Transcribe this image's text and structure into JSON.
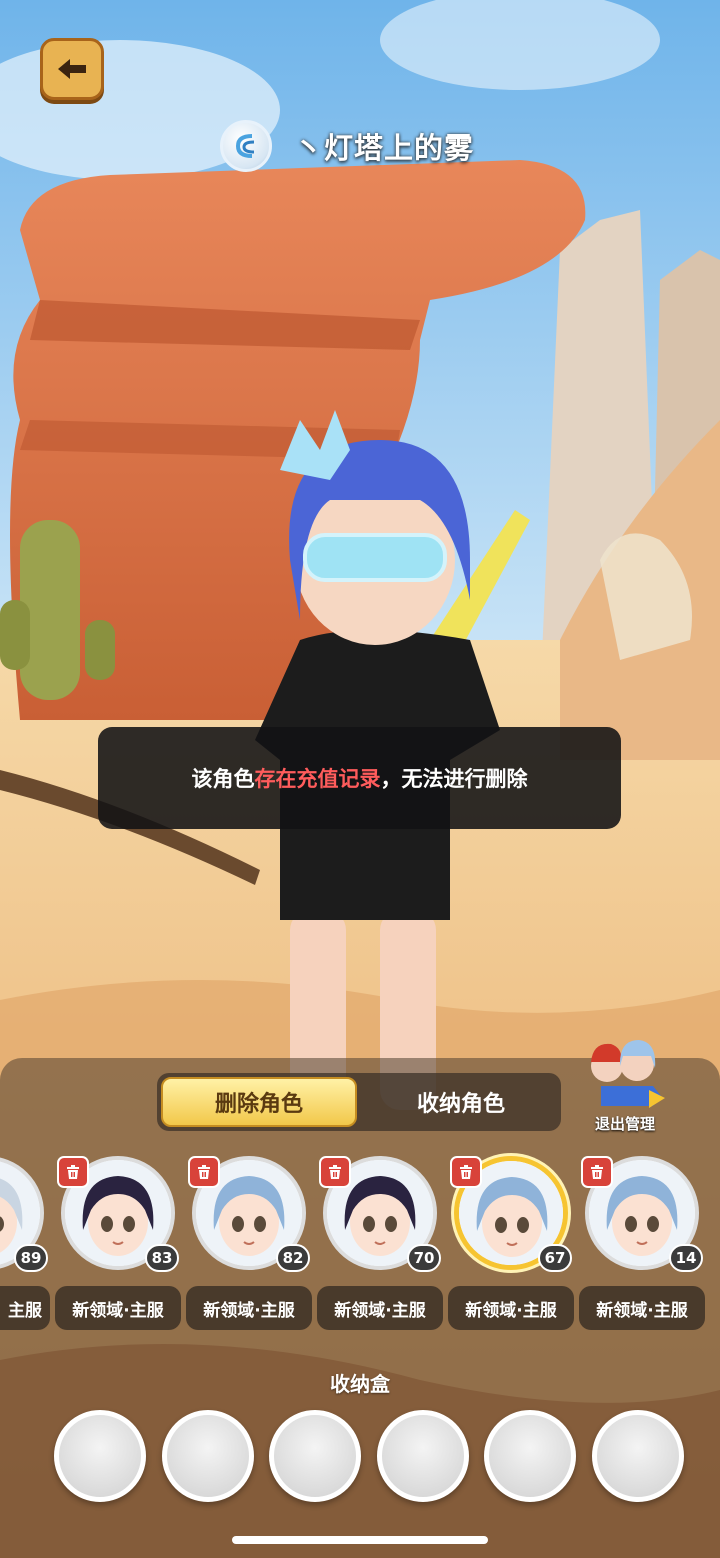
{
  "header": {
    "back_icon": "back-arrow-icon",
    "player_name": "丶灯塔上的雾",
    "badge_icon": "clan-badge-icon"
  },
  "toast": {
    "prefix": "该角色",
    "highlight": "存在充值记录",
    "suffix": "，无法进行删除",
    "highlight_color": "#ff5c5c"
  },
  "tabs": [
    {
      "label": "删除角色",
      "active": true
    },
    {
      "label": "收纳角色",
      "active": false
    }
  ],
  "exit": {
    "label": "退出管理",
    "icon": "exit-manage-icon"
  },
  "characters": [
    {
      "level": "89",
      "server": "主服",
      "hair": "#c9d5e2",
      "selected": false,
      "trash": false
    },
    {
      "level": "83",
      "server": "新领域·主服",
      "hair": "#2a2340",
      "selected": false,
      "trash": true
    },
    {
      "level": "82",
      "server": "新领域·主服",
      "hair": "#8fb3d9",
      "selected": false,
      "trash": true
    },
    {
      "level": "70",
      "server": "新领域·主服",
      "hair": "#2a2340",
      "selected": false,
      "trash": true
    },
    {
      "level": "67",
      "server": "新领域·主服",
      "hair": "#8fb3d9",
      "selected": true,
      "trash": true
    },
    {
      "level": "14",
      "server": "新领域·主服",
      "hair": "#8fb3d9",
      "selected": false,
      "trash": true
    }
  ],
  "storage": {
    "label": "收纳盒",
    "slot_count": 6
  },
  "colors": {
    "tab_active": "#f2c84a",
    "trash": "#d8433a",
    "selected_ring": "#f6c431"
  }
}
